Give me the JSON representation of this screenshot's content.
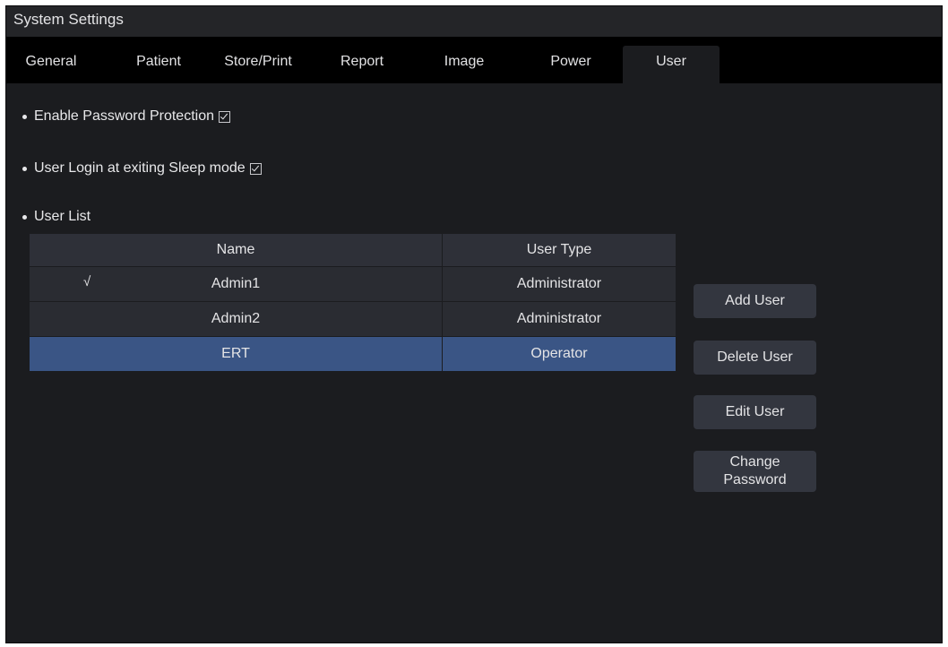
{
  "window": {
    "title": "System Settings"
  },
  "tabs": [
    {
      "label": "General"
    },
    {
      "label": "Patient"
    },
    {
      "label": "Store/Print"
    },
    {
      "label": "Report"
    },
    {
      "label": "Image"
    },
    {
      "label": "Power"
    },
    {
      "label": "User",
      "active": true
    }
  ],
  "options": {
    "password_protection": {
      "label": "Enable Password Protection",
      "checked": true
    },
    "login_on_wake": {
      "label": "User Login at exiting Sleep mode",
      "checked": true
    },
    "user_list_label": "User List"
  },
  "user_table": {
    "headers": [
      "Name",
      "User Type"
    ],
    "check_mark": "√",
    "rows": [
      {
        "name": "Admin1",
        "type": "Administrator",
        "current": true
      },
      {
        "name": "Admin2",
        "type": "Administrator"
      },
      {
        "name": "ERT",
        "type": "Operator",
        "selected": true
      }
    ]
  },
  "buttons": {
    "add": "Add User",
    "delete": "Delete User",
    "edit": "Edit User",
    "change_password_line1": "Change",
    "change_password_line2": "Password"
  },
  "colors": {
    "background": "#1b1c1f",
    "tab_strip": "#000000",
    "table_row": "#2a2c32",
    "selected_row": "#3a5585",
    "button": "#33363f"
  }
}
